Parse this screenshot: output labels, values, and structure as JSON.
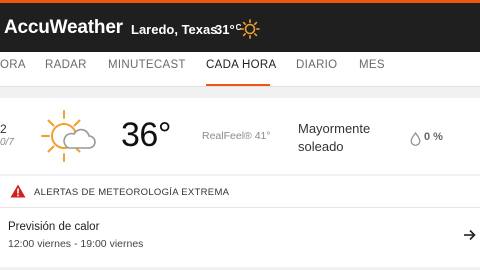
{
  "header": {
    "brand": "AccuWeather",
    "location": "Laredo, Texas",
    "current_temp": "31°",
    "current_temp_unit": "C",
    "current_icon": "sun-icon"
  },
  "nav": {
    "tabs": [
      {
        "label": "ORA"
      },
      {
        "label": "RADAR"
      },
      {
        "label": "MINUTECAST"
      },
      {
        "label": "CADA HORA"
      },
      {
        "label": "DIARIO"
      },
      {
        "label": "MES"
      }
    ],
    "active_tab": "CADA HORA"
  },
  "current": {
    "date_line1": "2",
    "date_line2": "0/7",
    "temperature": "36°",
    "realfeel_label": "RealFeel®",
    "realfeel_value": "41°",
    "condition": "Mayormente soleado",
    "precip": "0 %",
    "icon": "partly-sunny-icon"
  },
  "alerts": {
    "title": "ALERTAS DE METEOROLOGÍA EXTREMA",
    "items": [
      {
        "name": "Previsión de calor",
        "time": "12:00 viernes - 19:00 viernes"
      }
    ]
  },
  "colors": {
    "accent": "#f05514",
    "topbar": "#1f1f1f",
    "sun": "#f0a030",
    "alert": "#d0231f"
  }
}
